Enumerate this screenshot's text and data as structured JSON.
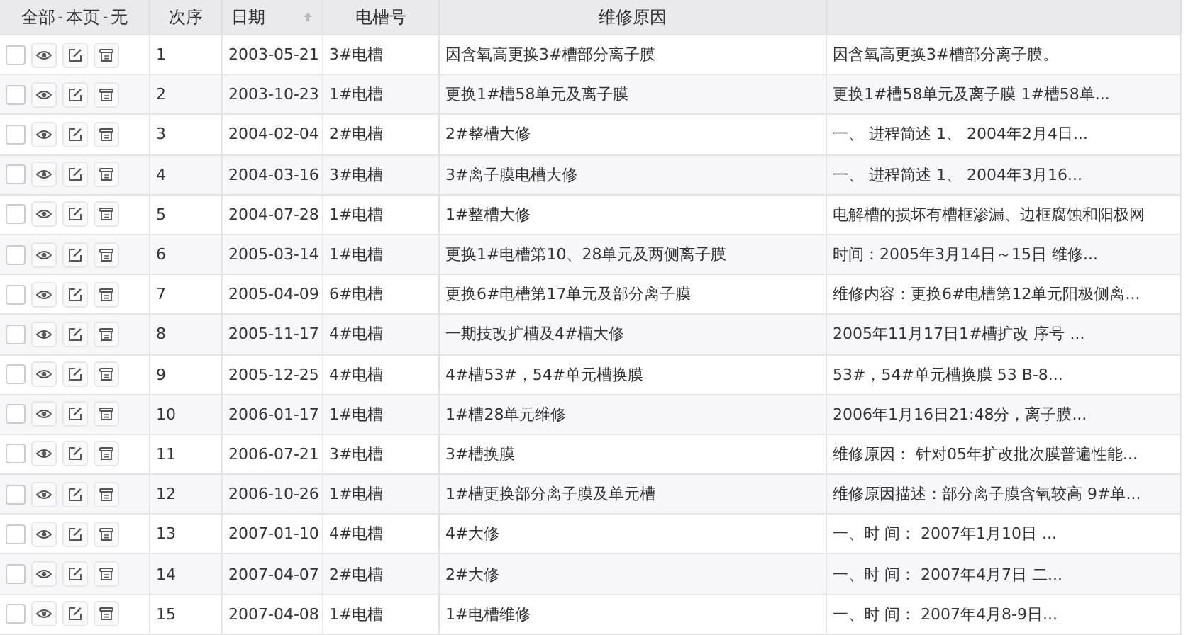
{
  "table": {
    "select_header": {
      "options": [
        "全部",
        "本页",
        "无"
      ],
      "separator": "-"
    },
    "columns": [
      {
        "label": "次序",
        "sorted": false
      },
      {
        "label": "日期",
        "sorted": true
      },
      {
        "label": "电槽号",
        "sorted": false
      },
      {
        "label": "维修原因",
        "sorted": false
      }
    ],
    "rows": [
      {
        "checked": false,
        "seq": "1",
        "date": "2003-05-21",
        "tank": "3#电槽",
        "reason": "因含氧高更换3#槽部分离子膜",
        "detail": "因含氧高更换3#槽部分离子膜。"
      },
      {
        "checked": false,
        "seq": "2",
        "date": "2003-10-23",
        "tank": "1#电槽",
        "reason": "更换1#槽58单元及离子膜",
        "detail": "更换1#槽58单元及离子膜 1#槽58单..."
      },
      {
        "checked": false,
        "seq": "3",
        "date": "2004-02-04",
        "tank": "2#电槽",
        "reason": "2#整槽大修",
        "detail": "一、  进程简述 1、 2004年2月4日..."
      },
      {
        "checked": false,
        "seq": "4",
        "date": "2004-03-16",
        "tank": "3#电槽",
        "reason": "3#离子膜电槽大修",
        "detail": "一、  进程简述 1、 2004年3月16..."
      },
      {
        "checked": false,
        "seq": "5",
        "date": "2004-07-28",
        "tank": "1#电槽",
        "reason": "1#整槽大修",
        "detail": "电解槽的损坏有槽框渗漏、边框腐蚀和阳极网"
      },
      {
        "checked": false,
        "seq": "6",
        "date": "2005-03-14",
        "tank": "1#电槽",
        "reason": "更换1#电槽第10、28单元及两侧离子膜",
        "detail": "时间：2005年3月14日～15日 维修..."
      },
      {
        "checked": false,
        "seq": "7",
        "date": "2005-04-09",
        "tank": "6#电槽",
        "reason": "更换6#电槽第17单元及部分离子膜",
        "detail": "维修内容：更换6#电槽第12单元阳极侧离..."
      },
      {
        "checked": false,
        "seq": "8",
        "date": "2005-11-17",
        "tank": "4#电槽",
        "reason": "一期技改扩槽及4#槽大修",
        "detail": "2005年11月17日1#槽扩改 序号 ..."
      },
      {
        "checked": false,
        "seq": "9",
        "date": "2005-12-25",
        "tank": "4#电槽",
        "reason": "4#槽53#，54#单元槽换膜",
        "detail": "53#，54#单元槽换膜 53 B-8..."
      },
      {
        "checked": false,
        "seq": "10",
        "date": "2006-01-17",
        "tank": "1#电槽",
        "reason": "1#槽28单元维修",
        "detail": "2006年1月16日21:48分，离子膜..."
      },
      {
        "checked": false,
        "seq": "11",
        "date": "2006-07-21",
        "tank": "3#电槽",
        "reason": "3#槽换膜",
        "detail": "维修原因： 针对05年扩改批次膜普遍性能..."
      },
      {
        "checked": false,
        "seq": "12",
        "date": "2006-10-26",
        "tank": "1#电槽",
        "reason": "1#槽更换部分离子膜及单元槽",
        "detail": "维修原因描述：部分离子膜含氧较高 9#单..."
      },
      {
        "checked": false,
        "seq": "13",
        "date": "2007-01-10",
        "tank": "4#电槽",
        "reason": "4#大修",
        "detail": "一、时 间： 2007年1月10日 ..."
      },
      {
        "checked": false,
        "seq": "14",
        "date": "2007-04-07",
        "tank": "2#电槽",
        "reason": "2#大修",
        "detail": "一、时 间： 2007年4月7日 二..."
      },
      {
        "checked": false,
        "seq": "15",
        "date": "2007-04-08",
        "tank": "1#电槽",
        "reason": "1#电槽维修",
        "detail": "一、时 间： 2007年4月8-9日..."
      }
    ]
  }
}
